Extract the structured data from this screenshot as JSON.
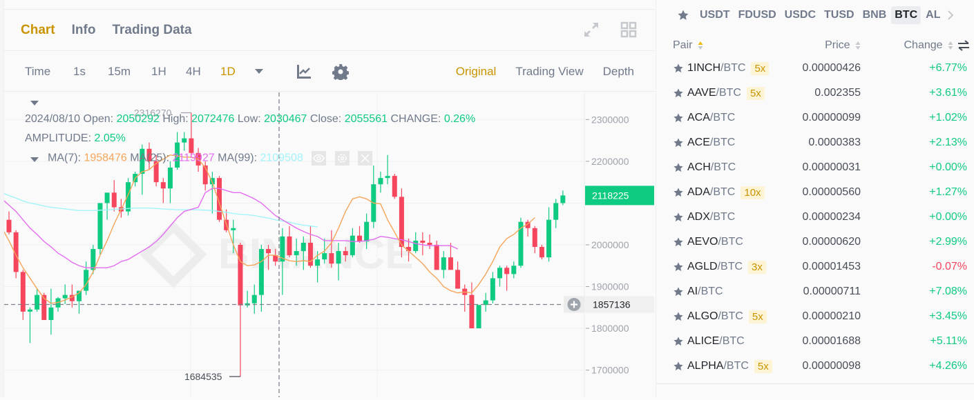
{
  "chart_panel": {
    "tabs": [
      {
        "label": "Chart",
        "active": true
      },
      {
        "label": "Info",
        "active": false
      },
      {
        "label": "Trading Data",
        "active": false
      }
    ],
    "top_icons": [
      "expand-icon",
      "grid-layout-icon"
    ],
    "intervals": [
      {
        "label": "Time",
        "active": false
      },
      {
        "label": "1s",
        "active": false
      },
      {
        "label": "15m",
        "active": false
      },
      {
        "label": "1H",
        "active": false
      },
      {
        "label": "4H",
        "active": false
      },
      {
        "label": "1D",
        "active": true
      }
    ],
    "toolbar_icons": [
      "chevron-down-icon",
      "indicator-icon",
      "gear-icon"
    ],
    "views": [
      {
        "label": "Original",
        "active": true
      },
      {
        "label": "Trading View",
        "active": false
      },
      {
        "label": "Depth",
        "active": false
      }
    ],
    "ohlc": {
      "date": "2024/08/10",
      "open_label": "Open:",
      "open": "2050292",
      "high_label": "High:",
      "high": "2072476",
      "low_label": "Low:",
      "low": "2030467",
      "close_label": "Close:",
      "close": "2055561",
      "change_label": "CHANGE:",
      "change": "0.26%",
      "amplitude_label": "AMPLITUDE:",
      "amplitude": "2.05%"
    },
    "ma": {
      "ma7_label": "MA(7):",
      "ma7": "1958476",
      "ma25_label": "MA(25):",
      "ma25": "2119927",
      "ma99_label": "MA(99):",
      "ma99": "2109508"
    },
    "ma_controls": [
      "eye-icon",
      "gear-icon",
      "close-icon"
    ],
    "watermark": "BINANCE",
    "colors": {
      "up": "#0ecb81",
      "down": "#f6465d",
      "ma7": "#f5a55a",
      "ma25": "#e46cf0",
      "ma99": "#a3f4f9",
      "accent": "#c99400"
    }
  },
  "chart_data": {
    "type": "candlestick",
    "title": "",
    "ylabel": "",
    "xlabel": "",
    "ylim": [
      1635000,
      2365000
    ],
    "y_ticks": [
      1700000,
      1800000,
      1900000,
      2000000,
      2100000,
      2200000,
      2300000
    ],
    "y_tick_labels": [
      "1700000",
      "1800000",
      "1900000",
      "2000000",
      "2200000",
      "2300000"
    ],
    "last_price": "2118225",
    "crosshair_price": "1857136",
    "max_label": "2316270",
    "min_label": "1684535",
    "grid": true,
    "candles": [
      [
        2060000,
        2080000,
        2025000,
        2030000
      ],
      [
        2030000,
        2035000,
        1920000,
        1935000
      ],
      [
        1935000,
        1940000,
        1820000,
        1840000
      ],
      [
        1840000,
        1850000,
        1765000,
        1845000
      ],
      [
        1845000,
        1895000,
        1840000,
        1880000
      ],
      [
        1880000,
        1885000,
        1820000,
        1820000
      ],
      [
        1820000,
        1895000,
        1785000,
        1850000
      ],
      [
        1850000,
        1875000,
        1840000,
        1872000
      ],
      [
        1872000,
        1905000,
        1858000,
        1880000
      ],
      [
        1880000,
        1905000,
        1850000,
        1865000
      ],
      [
        1865000,
        1885000,
        1835000,
        1890000
      ],
      [
        1890000,
        1960000,
        1880000,
        1940000
      ],
      [
        1940000,
        2000000,
        1930000,
        1990000
      ],
      [
        1990000,
        2090000,
        1975000,
        2100000
      ],
      [
        2100000,
        2110000,
        2060000,
        2125000
      ],
      [
        2125000,
        2155000,
        2080000,
        2090000
      ],
      [
        2090000,
        2110000,
        2065000,
        2080000
      ],
      [
        2080000,
        2160000,
        2070000,
        2150000
      ],
      [
        2150000,
        2175000,
        2140000,
        2170000
      ],
      [
        2170000,
        2240000,
        2120000,
        2230000
      ],
      [
        2230000,
        2245000,
        2180000,
        2200000
      ],
      [
        2200000,
        2215000,
        2140000,
        2150000
      ],
      [
        2150000,
        2160000,
        2100000,
        2135000
      ],
      [
        2135000,
        2200000,
        2100000,
        2185000
      ],
      [
        2185000,
        2270000,
        2180000,
        2245000
      ],
      [
        2245000,
        2270000,
        2225000,
        2255000
      ],
      [
        2255000,
        2316270,
        2210000,
        2220000
      ],
      [
        2220000,
        2232000,
        2175000,
        2190000
      ],
      [
        2190000,
        2200000,
        2130000,
        2145000
      ],
      [
        2145000,
        2175000,
        2075000,
        2160000
      ],
      [
        2160000,
        2165000,
        2055000,
        2060000
      ],
      [
        2060000,
        2085000,
        2030000,
        2035000
      ],
      [
        2035000,
        2060000,
        1980000,
        2040000
      ],
      [
        2000000,
        2005000,
        1684535,
        1855000
      ],
      [
        1855000,
        1890000,
        1850000,
        1860000
      ],
      [
        1860000,
        1905000,
        1835000,
        1880000
      ],
      [
        1880000,
        2000000,
        1840000,
        1990000
      ],
      [
        1990000,
        2000000,
        1940000,
        1980000
      ],
      [
        1975000,
        1990000,
        1950000,
        1960000
      ],
      [
        1960000,
        2040000,
        1880000,
        2020000
      ],
      [
        2020000,
        2045000,
        1970000,
        1975000
      ],
      [
        1975000,
        2015000,
        1950000,
        1985000
      ],
      [
        1985000,
        2020000,
        1940000,
        2005000
      ],
      [
        2005000,
        2045000,
        1945000,
        1950000
      ],
      [
        1950000,
        1985000,
        1910000,
        1965000
      ],
      [
        1965000,
        2015000,
        1955000,
        1980000
      ],
      [
        1980000,
        2035000,
        1945000,
        1955000
      ],
      [
        1955000,
        2005000,
        1915000,
        1985000
      ],
      [
        1985000,
        1995000,
        1960000,
        1975000
      ],
      [
        1975000,
        2040000,
        1970000,
        2022000
      ],
      [
        2022000,
        2045000,
        2005000,
        2008000
      ],
      [
        2008000,
        2075000,
        1990000,
        2055000
      ],
      [
        2055000,
        2190000,
        2040000,
        2145000
      ],
      [
        2145000,
        2175000,
        2125000,
        2160000
      ],
      [
        2160000,
        2215000,
        2145000,
        2165000
      ],
      [
        2165000,
        2170000,
        2110000,
        2115000
      ],
      [
        2115000,
        2135000,
        1970000,
        1995000
      ],
      [
        1995000,
        2015000,
        1960000,
        1985000
      ],
      [
        1985000,
        2030000,
        1980000,
        2010000
      ],
      [
        2010000,
        2030000,
        1975000,
        2005000
      ],
      [
        2005000,
        2025000,
        1990000,
        2000000
      ],
      [
        2000000,
        2010000,
        1960000,
        1940000
      ],
      [
        1940000,
        1985000,
        1920000,
        1970000
      ],
      [
        1970000,
        2005000,
        1945000,
        1940000
      ],
      [
        1940000,
        1960000,
        1895000,
        1895000
      ],
      [
        1895000,
        1905000,
        1840000,
        1880000
      ],
      [
        1880000,
        1910000,
        1830000,
        1800000
      ],
      [
        1800000,
        1815000,
        1835000,
        1856000
      ],
      [
        1856000,
        1885000,
        1840000,
        1867000
      ],
      [
        1867000,
        1935000,
        1860000,
        1920000
      ],
      [
        1920000,
        1950000,
        1900000,
        1945000
      ],
      [
        1945000,
        1950000,
        1890000,
        1930000
      ],
      [
        1930000,
        1960000,
        1920000,
        1950000
      ],
      [
        1950000,
        2065000,
        1945000,
        2055000
      ],
      [
        2055000,
        2060000,
        2020000,
        2040000
      ],
      [
        2040000,
        2045000,
        1980000,
        1995000
      ],
      [
        1995000,
        2000000,
        1965000,
        1970000
      ],
      [
        1970000,
        2090000,
        1960000,
        2060000
      ],
      [
        2060000,
        2110000,
        2040000,
        2100000
      ],
      [
        2100000,
        2130000,
        2095000,
        2118225
      ]
    ],
    "ma7": [
      2040000,
      2010000,
      1975000,
      1945000,
      1920000,
      1895000,
      1872000,
      1860000,
      1862000,
      1868000,
      1875000,
      1885000,
      1905000,
      1935000,
      1975000,
      2010000,
      2050000,
      2085000,
      2120000,
      2160000,
      2175000,
      2180000,
      2195000,
      2205000,
      2215000,
      2213000,
      2210000,
      2210000,
      2205000,
      2185000,
      2150000,
      2100000,
      2050000,
      2000000,
      1960000,
      1950000,
      1952000,
      1960000,
      1975000,
      1975000,
      1968000,
      1962000,
      1960000,
      1962000,
      1960000,
      1975000,
      1985000,
      2005000,
      2040000,
      2080000,
      2110000,
      2115000,
      2110000,
      2100000,
      2098000,
      2060000,
      2030000,
      2000000,
      1985000,
      1970000,
      1955000,
      1935000,
      1920000,
      1900000,
      1890000,
      1885000,
      1887000,
      1885000,
      1905000,
      1930000,
      1960000,
      1995000,
      2015000,
      2025000,
      2040000,
      2050000,
      2065000
    ],
    "ma25": [
      2110000,
      2095000,
      2080000,
      2060000,
      2040000,
      2025000,
      2008000,
      1995000,
      1980000,
      1970000,
      1958000,
      1950000,
      1945000,
      1945000,
      1945000,
      1945000,
      1950000,
      1960000,
      1965000,
      1975000,
      1985000,
      1995000,
      2008000,
      2025000,
      2045000,
      2065000,
      2080000,
      2085000,
      2090000,
      2125000,
      2135000,
      2135000,
      2130000,
      2125000,
      2125000,
      2118000,
      2110000,
      2100000,
      2085000,
      2070000,
      2060000,
      2050000,
      2040000,
      2032000,
      2025000,
      2020000,
      2010000,
      2010000,
      2010000,
      2010000,
      2008000,
      2008000,
      2010000,
      2013000,
      2020000,
      2018000,
      2015000,
      2012000,
      2008000,
      2003000,
      2000000,
      1998000,
      1998000,
      1998000,
      1998000,
      1990000
    ],
    "ma99": [
      2125000,
      2118000,
      2112000,
      2105000,
      2100000,
      2097000,
      2093000,
      2090000,
      2088000,
      2086000,
      2084000,
      2082000,
      2082000,
      2082000,
      2083000,
      2084000,
      2085000,
      2086000,
      2087000,
      2088000,
      2088000,
      2088000,
      2087000,
      2086000,
      2085000,
      2084000,
      2084000,
      2084000,
      2084000,
      2083000,
      2082000,
      2080000,
      2078000,
      2075000,
      2073000,
      2072000,
      2070000,
      2067000,
      2064000,
      2060000,
      2057000,
      2054000,
      2050000,
      2047000,
      2045000,
      2043000
    ]
  },
  "market_panel": {
    "favorite_icon": "star-icon",
    "quote_tabs": [
      {
        "label": "USDT",
        "active": false
      },
      {
        "label": "FDUSD",
        "active": false
      },
      {
        "label": "USDC",
        "active": false
      },
      {
        "label": "TUSD",
        "active": false
      },
      {
        "label": "BNB",
        "active": false
      },
      {
        "label": "BTC",
        "active": true
      },
      {
        "label": "AL",
        "active": false
      }
    ],
    "next_icon": "chevron-right-icon",
    "headers": {
      "pair": "Pair",
      "price": "Price",
      "change": "Change"
    },
    "toggle_icon": "swap-icon",
    "rows": [
      {
        "base": "1INCH",
        "quote": "/BTC",
        "leverage": "5x",
        "price": "0.00000426",
        "change": "+6.77%",
        "dir": "up"
      },
      {
        "base": "AAVE",
        "quote": "/BTC",
        "leverage": "5x",
        "price": "0.002355",
        "change": "+3.61%",
        "dir": "up"
      },
      {
        "base": "ACA",
        "quote": "/BTC",
        "leverage": "",
        "price": "0.00000099",
        "change": "+1.02%",
        "dir": "up"
      },
      {
        "base": "ACE",
        "quote": "/BTC",
        "leverage": "",
        "price": "0.0000383",
        "change": "+2.13%",
        "dir": "up"
      },
      {
        "base": "ACH",
        "quote": "/BTC",
        "leverage": "",
        "price": "0.00000031",
        "change": "+0.00%",
        "dir": "up"
      },
      {
        "base": "ADA",
        "quote": "/BTC",
        "leverage": "10x",
        "price": "0.00000560",
        "change": "+1.27%",
        "dir": "up"
      },
      {
        "base": "ADX",
        "quote": "/BTC",
        "leverage": "",
        "price": "0.00000234",
        "change": "+0.00%",
        "dir": "up"
      },
      {
        "base": "AEVO",
        "quote": "/BTC",
        "leverage": "",
        "price": "0.00000620",
        "change": "+2.99%",
        "dir": "up"
      },
      {
        "base": "AGLD",
        "quote": "/BTC",
        "leverage": "3x",
        "price": "0.00001453",
        "change": "-0.07%",
        "dir": "down"
      },
      {
        "base": "AI",
        "quote": "/BTC",
        "leverage": "",
        "price": "0.00000711",
        "change": "+7.08%",
        "dir": "up"
      },
      {
        "base": "ALGO",
        "quote": "/BTC",
        "leverage": "5x",
        "price": "0.00000210",
        "change": "+3.45%",
        "dir": "up"
      },
      {
        "base": "ALICE",
        "quote": "/BTC",
        "leverage": "",
        "price": "0.00001688",
        "change": "+5.11%",
        "dir": "up"
      },
      {
        "base": "ALPHA",
        "quote": "/BTC",
        "leverage": "5x",
        "price": "0.00000098",
        "change": "+4.26%",
        "dir": "up"
      }
    ]
  }
}
